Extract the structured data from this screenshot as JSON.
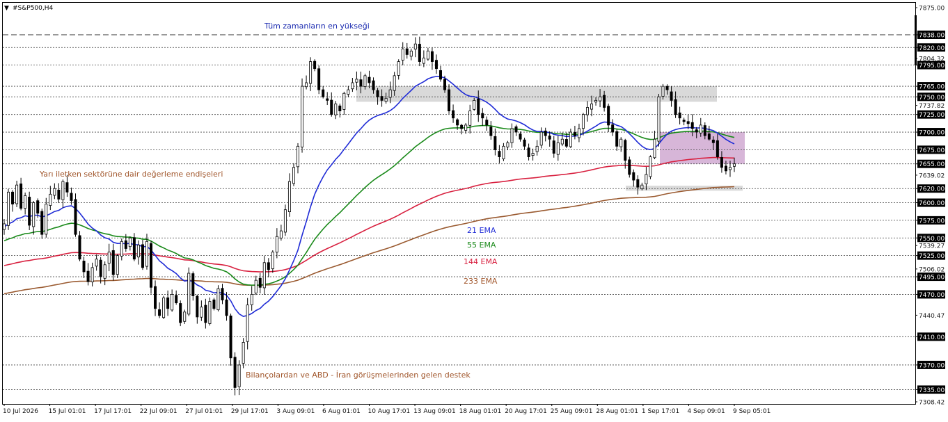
{
  "header": {
    "symbol_label": "#S&P500,H4"
  },
  "colors": {
    "ema21": "#1f2bd6",
    "ema55": "#1a8a1a",
    "ema144": "#d8203f",
    "ema233": "#9a5a30",
    "candle": "#000000",
    "zone_gray": "#d9d9d9",
    "zone_pink": "#d7b6d8",
    "level_label_bg": "#000000"
  },
  "annotations": {
    "ath": "Tüm zamanların en yükseği",
    "semis": "Yarı iletken sektörüne dair değerleme endişeleri",
    "support": "Bilançolardan ve ABD - İran görüşmelerinden gelen destek"
  },
  "legend": {
    "ema21": "21 EMA",
    "ema55": "55 EMA",
    "ema144": "144 EMA",
    "ema233": "233 EMA"
  },
  "chart_data": {
    "type": "candlestick",
    "title": "#S&P500,H4",
    "ylim": [
      7308.42,
      7875.0
    ],
    "ath_level": 7838.0,
    "dashed_levels": [
      7820,
      7795,
      7765,
      7750,
      7725,
      7700,
      7675,
      7655,
      7620,
      7600,
      7575,
      7550,
      7525,
      7495,
      7470,
      7410,
      7370,
      7335
    ],
    "y_ticks": [
      "7875.00",
      "7838.00",
      "7820.00",
      "7804.32",
      "7795.00",
      "7765.00",
      "7750.00",
      "7737.82",
      "7725.00",
      "7700.00",
      "7675.00",
      "7655.00",
      "7639.02",
      "7620.00",
      "7600.00",
      "7575.00",
      "7550.00",
      "7539.27",
      "7525.00",
      "7506.02",
      "7495.00",
      "7470.00",
      "7440.47",
      "7410.00",
      "7370.00",
      "7335.00",
      "7308.42"
    ],
    "x_ticks": [
      "10 Jul 2026",
      "15 Jul 01:01",
      "17 Jul 17:01",
      "22 Jul 09:01",
      "27 Jul 01:01",
      "29 Jul 17:01",
      "3 Aug 09:01",
      "6 Aug 01:01",
      "10 Aug 17:01",
      "13 Aug 09:01",
      "18 Aug 01:01",
      "20 Aug 17:01",
      "25 Aug 09:01",
      "28 Aug 01:01",
      "1 Sep 17:01",
      "4 Sep 09:01",
      "9 Sep 05:01"
    ],
    "closes": [
      7570,
      7615,
      7598,
      7625,
      7592,
      7610,
      7568,
      7600,
      7585,
      7555,
      7598,
      7612,
      7620,
      7605,
      7630,
      7615,
      7603,
      7555,
      7520,
      7502,
      7488,
      7508,
      7520,
      7495,
      7512,
      7530,
      7498,
      7525,
      7545,
      7535,
      7550,
      7520,
      7540,
      7508,
      7545,
      7480,
      7450,
      7440,
      7465,
      7450,
      7470,
      7458,
      7430,
      7445,
      7500,
      7468,
      7438,
      7452,
      7430,
      7460,
      7450,
      7478,
      7462,
      7440,
      7380,
      7338,
      7370,
      7402,
      7455,
      7470,
      7490,
      7480,
      7515,
      7505,
      7530,
      7552,
      7560,
      7590,
      7630,
      7650,
      7680,
      7765,
      7770,
      7800,
      7790,
      7760,
      7750,
      7745,
      7725,
      7740,
      7730,
      7755,
      7760,
      7770,
      7775,
      7765,
      7780,
      7770,
      7760,
      7750,
      7745,
      7748,
      7760,
      7780,
      7800,
      7818,
      7810,
      7815,
      7825,
      7800,
      7805,
      7815,
      7800,
      7790,
      7775,
      7760,
      7730,
      7720,
      7710,
      7705,
      7710,
      7730,
      7745,
      7725,
      7720,
      7710,
      7695,
      7675,
      7665,
      7680,
      7685,
      7705,
      7700,
      7690,
      7680,
      7665,
      7670,
      7680,
      7700,
      7695,
      7690,
      7670,
      7685,
      7690,
      7680,
      7700,
      7695,
      7705,
      7725,
      7735,
      7740,
      7745,
      7750,
      7735,
      7710,
      7700,
      7680,
      7690,
      7660,
      7640,
      7632,
      7622,
      7625,
      7640,
      7665,
      7690,
      7750,
      7765,
      7760,
      7745,
      7725,
      7720,
      7715,
      7712,
      7705,
      7700,
      7710,
      7695,
      7690,
      7685,
      7665,
      7650,
      7645,
      7650,
      7655
    ]
  }
}
